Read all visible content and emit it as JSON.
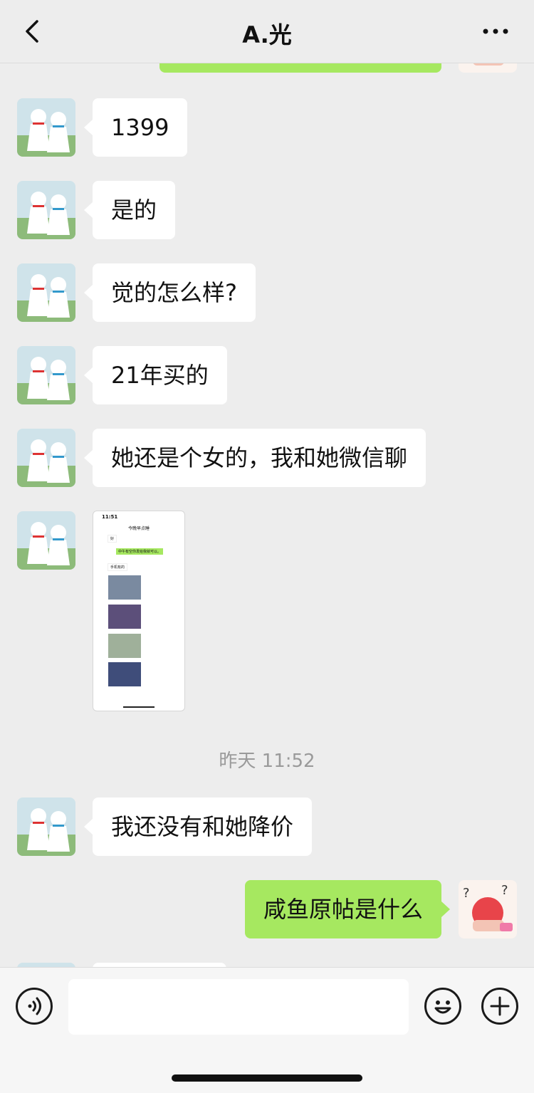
{
  "header": {
    "title": "A.光"
  },
  "messages": [
    {
      "text": "1399"
    },
    {
      "text": "是的"
    },
    {
      "text": "觉的怎么样?"
    },
    {
      "text": "21年买的"
    },
    {
      "text": "她还是个女的，我和她微信聊"
    },
    {
      "text": "我还没有和她降价"
    },
    {
      "text": "咸鱼原帖是什么"
    }
  ],
  "timestamp": "昨天 11:52",
  "screenshot_thumb": {
    "time": "11:51",
    "title": "今晚早点睡",
    "msg1": "好",
    "msg2": "中午有空你发给我就可以。",
    "msg3": "手机有的"
  },
  "colors": {
    "self_bubble": "#a6e860",
    "other_bubble": "#ffffff",
    "background": "#ededed"
  }
}
